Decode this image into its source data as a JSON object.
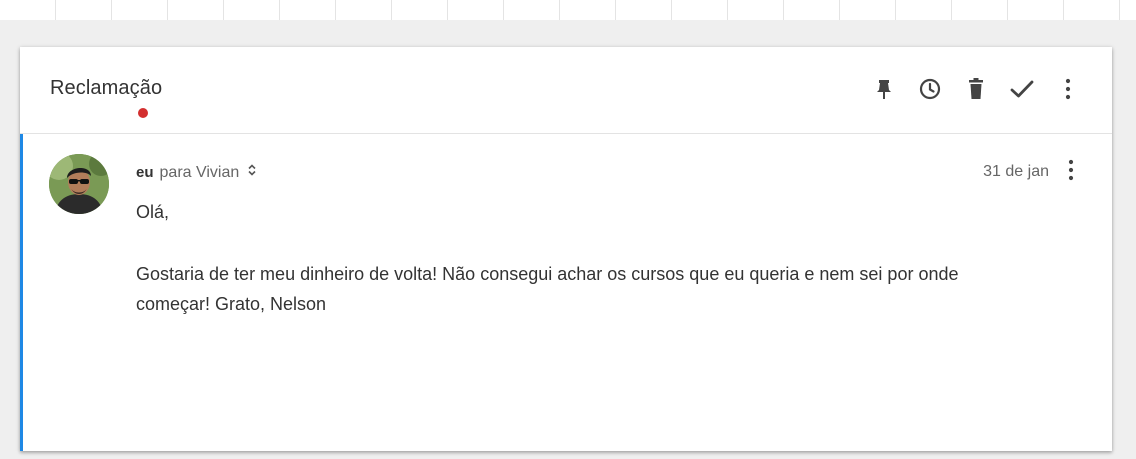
{
  "email": {
    "subject": "Reclamação",
    "toolbar": {
      "icons": [
        "pin-icon",
        "snooze-clock-icon",
        "trash-icon",
        "done-check-icon",
        "more-vert-icon"
      ]
    },
    "message": {
      "sender": "eu",
      "recipients": "para Vivian",
      "date": "31 de jan",
      "greeting": "Olá,",
      "body": "Gostaria de ter meu dinheiro de volta! Não consegui achar os cursos que eu queria e nem sei por onde começar! Grato, Nelson"
    }
  },
  "colors": {
    "unread_dot": "#d32f2f",
    "thread_accent": "#1e88e5",
    "icon": "#444444"
  }
}
